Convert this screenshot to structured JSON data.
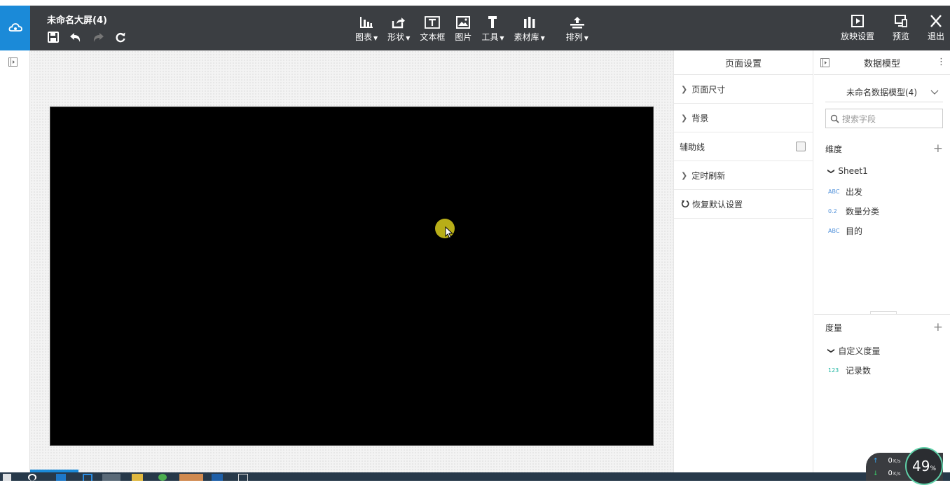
{
  "header": {
    "title": "未命名大屏(4)",
    "tools": [
      {
        "label": "图表",
        "icon": "bar-chart-icon",
        "dropdown": true
      },
      {
        "label": "形状",
        "icon": "shape-icon",
        "dropdown": true
      },
      {
        "label": "文本框",
        "icon": "textbox-icon",
        "dropdown": false
      },
      {
        "label": "图片",
        "icon": "image-icon",
        "dropdown": false
      },
      {
        "label": "工具",
        "icon": "hammer-icon",
        "dropdown": true
      },
      {
        "label": "素材库",
        "icon": "library-icon",
        "dropdown": true
      },
      {
        "label": "排列",
        "icon": "arrange-icon",
        "dropdown": true
      }
    ],
    "actions": [
      {
        "label": "放映设置",
        "icon": "play-icon"
      },
      {
        "label": "预览",
        "icon": "preview-icon"
      },
      {
        "label": "退出",
        "icon": "close-icon"
      }
    ]
  },
  "page_settings": {
    "title": "页面设置",
    "page_size": "页面尺寸",
    "background": "背景",
    "guide_lines": "辅助线",
    "timed_refresh": "定时刷新",
    "restore_defaults": "恢复默认设置"
  },
  "data_model": {
    "title": "数据模型",
    "selected_model": "未命名数据模型(4)",
    "search_placeholder": "搜索字段",
    "dimensions_label": "维度",
    "sheet": "Sheet1",
    "dimension_fields": [
      {
        "type": "ABC",
        "name": "出发"
      },
      {
        "type": "0.2",
        "name": "数量分类"
      },
      {
        "type": "ABC",
        "name": "目的"
      }
    ],
    "measures_label": "度量",
    "measure_group": "自定义度量",
    "measure_fields": [
      {
        "type": "123",
        "name": "记录数"
      }
    ]
  },
  "net_widget": {
    "upload": "0",
    "download": "0",
    "unit": "K/s",
    "percent": "49",
    "percent_sign": "%"
  },
  "colors": {
    "topbar": "#3b3e42",
    "accent": "#1b8ad8",
    "canvas": "#000000"
  }
}
